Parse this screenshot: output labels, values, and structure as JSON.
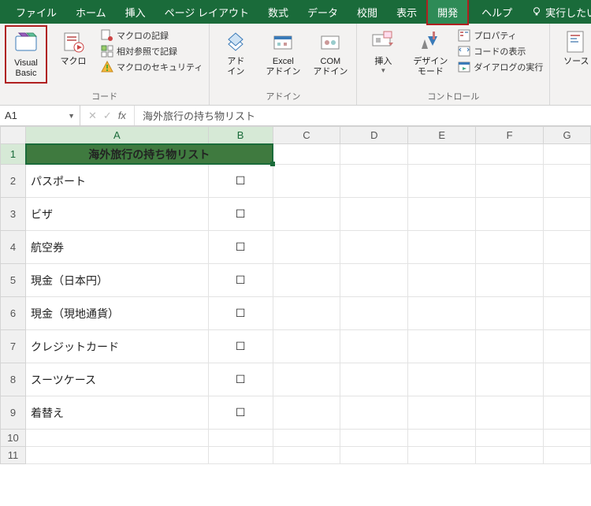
{
  "tabs": {
    "file": "ファイル",
    "home": "ホーム",
    "insert": "挿入",
    "pagelayout": "ページ レイアウト",
    "formulas": "数式",
    "data": "データ",
    "review": "校閲",
    "view": "表示",
    "developer": "開発",
    "help": "ヘルプ",
    "tellme": "実行したい"
  },
  "ribbon": {
    "code": {
      "label": "コード",
      "vb": "Visual Basic",
      "macros": "マクロ",
      "record": "マクロの記録",
      "relref": "相対参照で記録",
      "security": "マクロのセキュリティ"
    },
    "addins": {
      "label": "アドイン",
      "addin": "アド\nイン",
      "excel": "Excel\nアドイン",
      "com": "COM\nアドイン"
    },
    "controls": {
      "label": "コントロール",
      "insert": "挿入",
      "design": "デザイン\nモード",
      "props": "プロパティ",
      "viewcode": "コードの表示",
      "dialog": "ダイアログの実行"
    },
    "xml": {
      "source": "ソース"
    }
  },
  "fbar": {
    "name": "A1",
    "value": "海外旅行の持ち物リスト"
  },
  "cols": [
    "A",
    "B",
    "C",
    "D",
    "E",
    "F",
    "G"
  ],
  "sheet": {
    "header": "海外旅行の持ち物リスト",
    "items": [
      "パスポート",
      "ビザ",
      "航空券",
      "現金（日本円）",
      "現金（現地通貨）",
      "クレジットカード",
      "スーツケース",
      "着替え"
    ],
    "check": "☐"
  }
}
